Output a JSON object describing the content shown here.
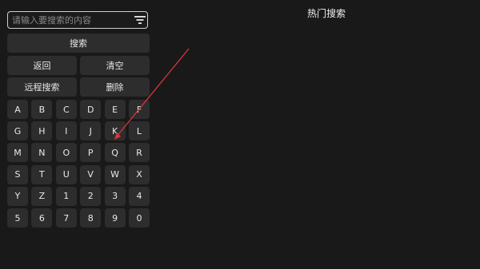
{
  "search": {
    "placeholder": "请输入要搜索的内容",
    "filter_icon": "filter-icon"
  },
  "actions": {
    "search_label": "搜索",
    "back_label": "返回",
    "clear_label": "清空",
    "remote_search_label": "远程搜索",
    "delete_label": "删除"
  },
  "keyboard": {
    "keys": [
      "A",
      "B",
      "C",
      "D",
      "E",
      "F",
      "G",
      "H",
      "I",
      "J",
      "K",
      "L",
      "M",
      "N",
      "O",
      "P",
      "Q",
      "R",
      "S",
      "T",
      "U",
      "V",
      "W",
      "X",
      "Y",
      "Z",
      "1",
      "2",
      "3",
      "4",
      "5",
      "6",
      "7",
      "8",
      "9",
      "0"
    ]
  },
  "hot": {
    "title": "热门搜索"
  },
  "annotation": {
    "color": "#d9363e"
  }
}
